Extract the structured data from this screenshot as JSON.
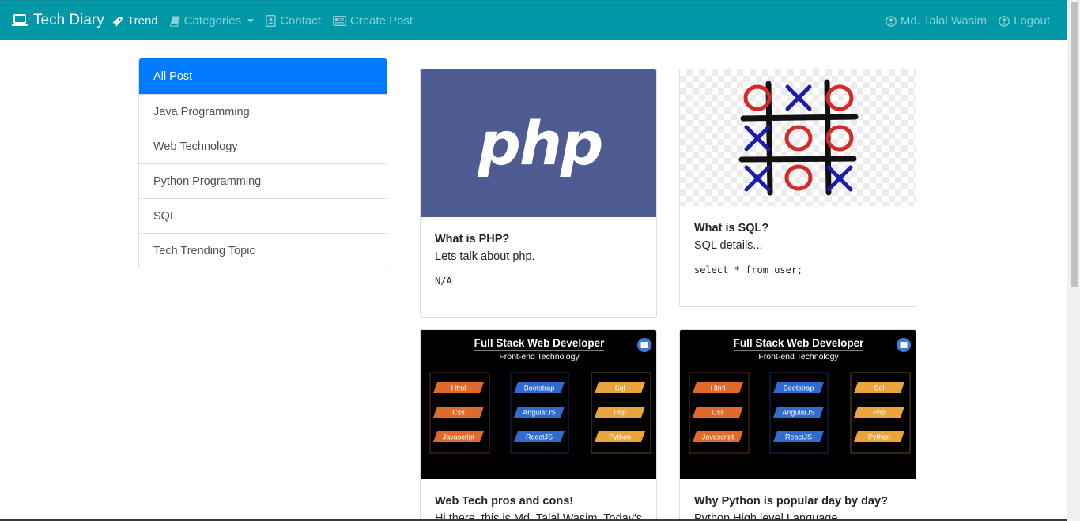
{
  "navbar": {
    "brand": "Tech Diary",
    "items": [
      {
        "label": "Trend",
        "icon": "rocket-icon",
        "active": true
      },
      {
        "label": "Categories",
        "icon": "book-icon",
        "dropdown": true
      },
      {
        "label": "Contact",
        "icon": "address-book-icon"
      },
      {
        "label": "Create Post",
        "icon": "newspaper-icon"
      }
    ],
    "user": {
      "label": "Md. Talal Wasim",
      "icon": "user-circle-icon"
    },
    "logout": {
      "label": "Logout",
      "icon": "user-circle-icon"
    }
  },
  "categories": [
    {
      "label": "All Post",
      "active": true
    },
    {
      "label": "Java Programming"
    },
    {
      "label": "Web Technology"
    },
    {
      "label": "Python Programming"
    },
    {
      "label": "SQL"
    },
    {
      "label": "Tech Trending Topic"
    }
  ],
  "posts": [
    {
      "title": "What is PHP?",
      "description": "Lets talk about php.",
      "code": "N/A",
      "image_text": "php"
    },
    {
      "title": "What is SQL?",
      "description": "SQL details...",
      "code": "select * from user;"
    },
    {
      "title": "Web Tech pros and cons!",
      "description": "Hi there, this is Md. Talal Wasim. Today's ..."
    },
    {
      "title": "Why Python is popular day by day?",
      "description": "Python High level Language..."
    }
  ],
  "banner": {
    "title": "Full Stack Web Developer",
    "subtitle": "Front-end Technology",
    "columns": [
      {
        "color": "#e06a2c",
        "items": [
          "Html",
          "Css",
          "Javascript"
        ]
      },
      {
        "color": "#2f6bd1",
        "items": [
          "Bootstrap",
          "AngularJS",
          "ReactJS"
        ]
      },
      {
        "color": "#e9a43a",
        "items": [
          "Sql",
          "Php",
          "Python"
        ]
      }
    ]
  },
  "colors": {
    "navbar": "#0097a7",
    "active": "#007bff",
    "php_bg": "#4f5b93"
  }
}
